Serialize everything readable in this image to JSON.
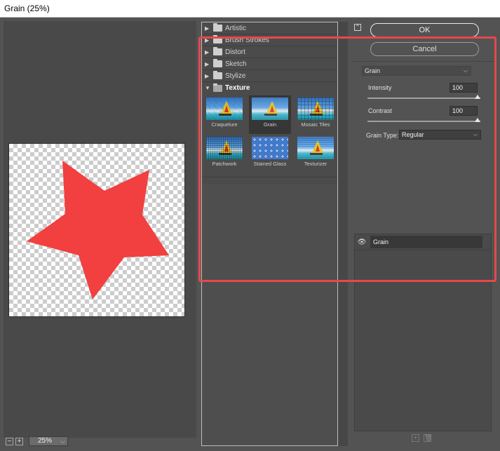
{
  "window": {
    "title": "Grain (25%)"
  },
  "preview": {
    "zoom_value": "25%",
    "zoom_out_symbol": "−",
    "zoom_in_symbol": "+"
  },
  "filter_gallery": {
    "categories": [
      {
        "label": "Artistic",
        "expanded": false
      },
      {
        "label": "Brush Strokes",
        "expanded": false
      },
      {
        "label": "Distort",
        "expanded": false
      },
      {
        "label": "Sketch",
        "expanded": false
      },
      {
        "label": "Stylize",
        "expanded": false
      },
      {
        "label": "Texture",
        "expanded": true
      }
    ],
    "texture_filters": [
      {
        "label": "Craquelure"
      },
      {
        "label": "Grain",
        "selected": true
      },
      {
        "label": "Mosaic Tiles"
      },
      {
        "label": "Patchwork"
      },
      {
        "label": "Stained Glass"
      },
      {
        "label": "Texturizer"
      }
    ]
  },
  "buttons": {
    "ok": "OK",
    "cancel": "Cancel"
  },
  "settings": {
    "filter_select": "Grain",
    "intensity_label": "Intensity",
    "intensity_value": "100",
    "contrast_label": "Contrast",
    "contrast_value": "100",
    "grain_type_label": "Grain Type:",
    "grain_type_value": "Regular"
  },
  "effect_layers": [
    {
      "name": "Grain",
      "visible": true
    }
  ],
  "colors": {
    "star": "#f23f3f",
    "highlight": "#e5484d",
    "panel": "#535353"
  }
}
